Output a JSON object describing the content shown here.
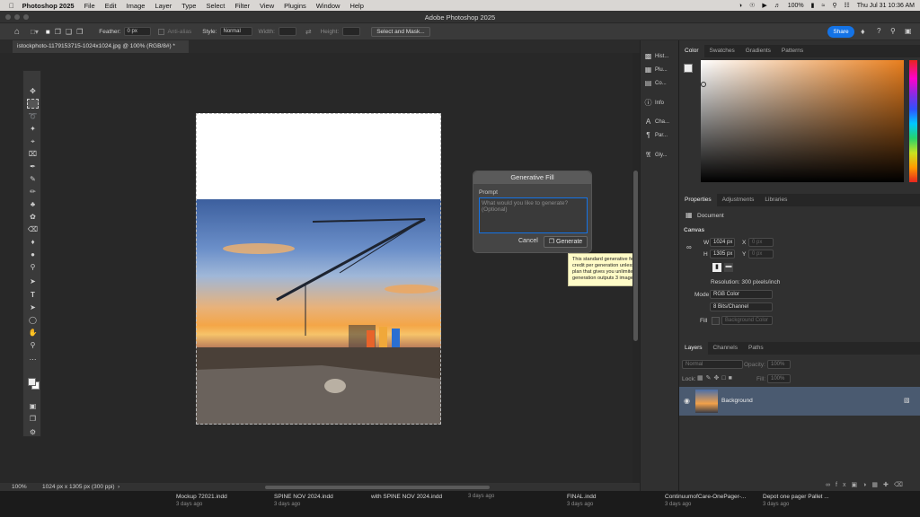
{
  "menubar": {
    "app": "Photoshop 2025",
    "items": [
      "File",
      "Edit",
      "Image",
      "Layer",
      "Type",
      "Select",
      "Filter",
      "View",
      "Plugins",
      "Window",
      "Help"
    ],
    "battery": "100%",
    "clock": "Thu Jul 31  10:36 AM"
  },
  "window": {
    "title": "Adobe Photoshop 2025"
  },
  "options": {
    "feather_label": "Feather:",
    "feather_value": "0 px",
    "antialias_label": "Anti-alias",
    "style_label": "Style:",
    "style_value": "Normal",
    "width_label": "Width:",
    "height_label": "Height:",
    "select_mask": "Select and Mask...",
    "share": "Share"
  },
  "document": {
    "tab_title": "istockphoto-1179153715-1024x1024.jpg @ 100% (RGB/8#) *"
  },
  "generative_fill": {
    "title": "Generative Fill",
    "prompt_label": "Prompt",
    "prompt_placeholder": "What would you like to generate? (Optional)",
    "cancel": "Cancel",
    "generate": "Generate"
  },
  "tooltip": "This standard generative feature uses 1 credit per generation unless you have a plan that gives you unlimited access. Each generation outputs 3 images.",
  "status": {
    "zoom": "100%",
    "info": "1024 px x 1305 px (300 ppi)"
  },
  "panel_icons": [
    "Hist...",
    "Plu...",
    "Co...",
    "Info",
    "Cha...",
    "Par...",
    "Gly..."
  ],
  "color_tabs": [
    "Color",
    "Swatches",
    "Gradients",
    "Patterns"
  ],
  "properties_tabs": [
    "Properties",
    "Adjustments",
    "Libraries"
  ],
  "properties": {
    "document_label": "Document",
    "canvas_label": "Canvas",
    "w_label": "W",
    "w_value": "1024 px",
    "x_label": "X",
    "x_value": "0 px",
    "h_label": "H",
    "h_value": "1305 px",
    "y_label": "Y",
    "y_value": "0 px",
    "resolution": "Resolution: 300 pixels/inch",
    "mode_label": "Mode",
    "mode_value": "RGB Color",
    "bits_value": "8 Bits/Channel",
    "fill_label": "Fill",
    "fill_value": "Background Color"
  },
  "layers_tabs": [
    "Layers",
    "Channels",
    "Paths"
  ],
  "layers": {
    "blend": "Normal",
    "opacity_label": "Opacity:",
    "opacity_value": "100%",
    "lock_label": "Lock:",
    "fill_label": "Fill:",
    "fill_value": "100%",
    "layer_name": "Background"
  },
  "dock": [
    {
      "name": "Mockup 72021.indd",
      "date": "3 days ago"
    },
    {
      "name": "SPINE NOV 2024.indd",
      "date": "3 days ago"
    },
    {
      "name": "with SPINE NOV 2024.indd",
      "date": "3 days ago"
    },
    {
      "name": "FINAL.indd",
      "date": "3 days ago"
    },
    {
      "name": "ContinuumofCare-OnePager-...",
      "date": "3 days ago"
    },
    {
      "name": "Depot one pager Pallet ...",
      "date": "3 days ago"
    }
  ],
  "colors": {
    "accent": "#1473e6",
    "tooltip_bg": "#fffbc7",
    "layer_selected": "#4a5a70"
  }
}
